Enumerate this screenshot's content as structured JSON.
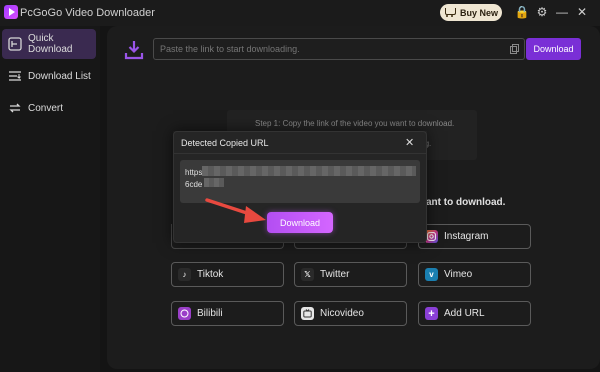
{
  "app": {
    "title": "PcGoGo Video Downloader",
    "buy_label": "Buy New"
  },
  "window_controls": [
    {
      "name": "lock-icon",
      "glyph": "🔒"
    },
    {
      "name": "settings-icon",
      "glyph": "⚙"
    },
    {
      "name": "minimize-icon",
      "glyph": "—"
    },
    {
      "name": "close-icon",
      "glyph": "✕"
    }
  ],
  "sidebar": {
    "items": [
      {
        "label": "Quick Download",
        "icon": "quick-download-icon",
        "active": true
      },
      {
        "label": "Download List",
        "icon": "list-icon",
        "active": false
      },
      {
        "label": "Convert",
        "icon": "convert-icon",
        "active": false
      }
    ]
  },
  "toolbar": {
    "input_placeholder": "Paste the link to start downloading.",
    "download_label": "Download"
  },
  "steps": {
    "step1": "Step 1: Copy the link of the video you want to download.",
    "step2_visible": "oading.",
    "want_visible": "ant to download."
  },
  "sites": [
    {
      "label": "Instagram",
      "icon": "instagram-icon",
      "color": "#c13584"
    },
    {
      "label": "Tiktok",
      "icon": "tiktok-icon",
      "color": "#2a2a2a"
    },
    {
      "label": "Twitter",
      "icon": "x-icon",
      "color": "#2a2a2a"
    },
    {
      "label": "Vimeo",
      "icon": "vimeo-icon",
      "color": "#1ab7ea"
    },
    {
      "label": "Bilibili",
      "icon": "bilibili-icon",
      "color": "#b44bd8"
    },
    {
      "label": "Nicovideo",
      "icon": "nicovideo-icon",
      "color": "#cfcfcf"
    },
    {
      "label": "Add URL",
      "icon": "add-icon",
      "color": "#8a3fd6"
    }
  ],
  "dialog": {
    "title": "Detected Copied URL",
    "close": "✕",
    "url_line1": "https",
    "url_line2": "6cde",
    "download_label": "Download"
  },
  "colors": {
    "accent": "#7a2fd6",
    "dialog_button": "#c45cfa",
    "arrow": "#e8493f",
    "buy": "#efe6d2"
  }
}
